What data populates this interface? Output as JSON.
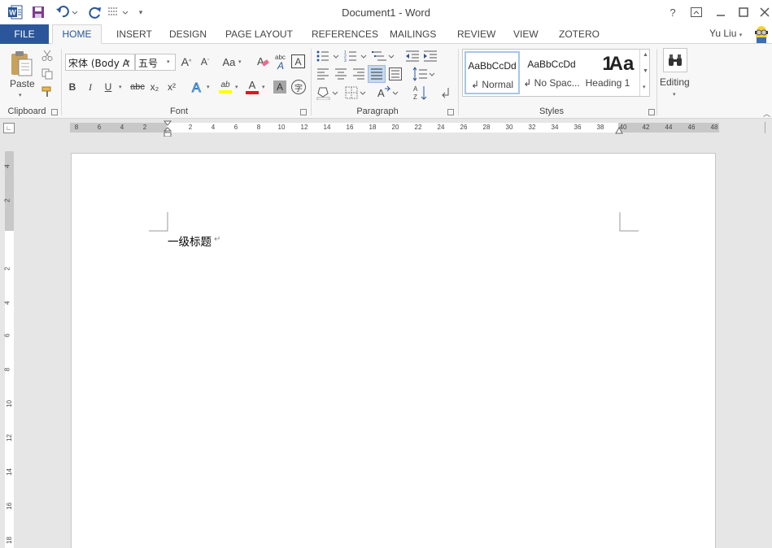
{
  "app": {
    "title": "Document1 - Word",
    "user": "Yu Liu"
  },
  "quick_access": [
    "word-logo-icon",
    "save-icon",
    "undo-icon",
    "redo-icon",
    "touch-mode-icon",
    "customize-icon"
  ],
  "window_controls": {
    "help": "?",
    "ribbon_options": "⊡",
    "minimize": "—",
    "restore": "☐",
    "close": "✕"
  },
  "tabs": {
    "file": "FILE",
    "home": "HOME",
    "insert": "INSERT",
    "design": "DESIGN",
    "page_layout": "PAGE LAYOUT",
    "references": "REFERENCES",
    "mailings": "MAILINGS",
    "review": "REVIEW",
    "view": "VIEW",
    "zotero": "ZOTERO"
  },
  "clipboard": {
    "label": "Clipboard",
    "paste": "Paste"
  },
  "font": {
    "label": "Font",
    "family": "宋体 (Body A",
    "size": "五号",
    "grow": "A",
    "shrink": "A",
    "case": "Aa",
    "bold": "B",
    "italic": "I",
    "underline": "U",
    "strike": "abc",
    "subscript": "x₂",
    "superscript": "x²",
    "text_effects": "A",
    "highlight": "ab",
    "font_color": "A",
    "char_shading": "A",
    "enclose": "字",
    "clear_format": "A",
    "phonetic": "abc",
    "char_border": "A",
    "highlight_color": "#ffff00",
    "font_color_value": "#e81123"
  },
  "paragraph": {
    "label": "Paragraph"
  },
  "styles": {
    "label": "Styles",
    "items": [
      {
        "preview": "AaBbCcDd",
        "name": "Normal"
      },
      {
        "preview": "AaBbCcDd",
        "name": "No Spac..."
      },
      {
        "preview": "1",
        "name": "Heading 1"
      },
      {
        "preview": "Aa",
        "name": ""
      }
    ]
  },
  "editing": {
    "label": "Editing"
  },
  "ruler": {
    "horizontal_labels": [
      "8",
      "6",
      "4",
      "2",
      "2",
      "4",
      "6",
      "8",
      "10",
      "12",
      "14",
      "16",
      "18",
      "20",
      "22",
      "24",
      "26",
      "28",
      "30",
      "32",
      "34",
      "36",
      "38",
      "40",
      "42",
      "44",
      "46",
      "48"
    ],
    "vertical_labels": [
      "4",
      "2",
      "2",
      "4",
      "6",
      "8",
      "10",
      "12",
      "14",
      "16",
      "18"
    ]
  },
  "document": {
    "text": "一级标题",
    "paragraph_mark": "↵"
  },
  "colors": {
    "accent": "#2b579a",
    "ribbon_bg": "#f7f7f7",
    "workspace_bg": "#e6e6e6"
  }
}
